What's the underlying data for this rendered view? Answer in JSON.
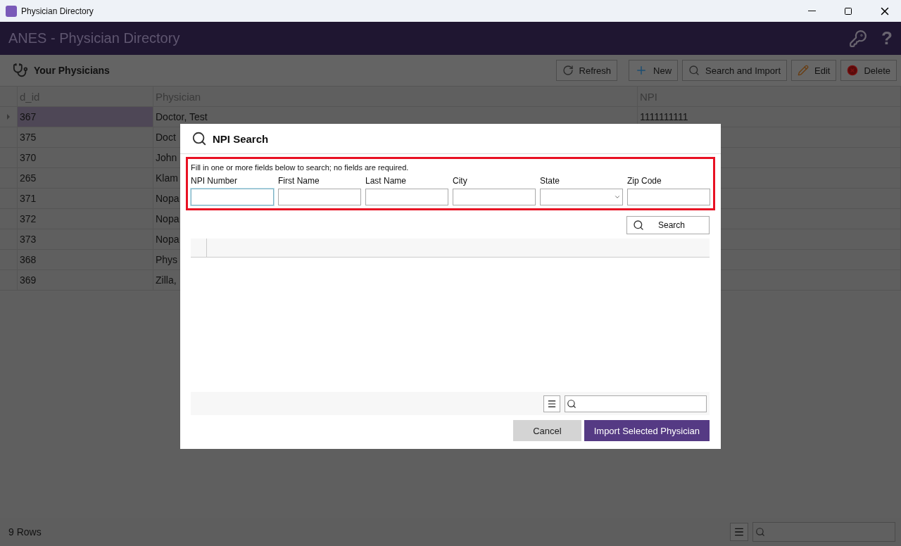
{
  "window": {
    "title": "Physician Directory"
  },
  "app_header": {
    "title": "ANES - Physician Directory",
    "help": "?"
  },
  "toolbar": {
    "title": "Your Physicians",
    "buttons": [
      {
        "label": "Refresh",
        "kind": "refresh"
      },
      {
        "label": "New",
        "kind": "new"
      },
      {
        "label": "Search and Import",
        "kind": "search"
      },
      {
        "label": "Edit",
        "kind": "edit"
      },
      {
        "label": "Delete",
        "kind": "delete"
      }
    ]
  },
  "table": {
    "columns": [
      "d_id",
      "Physician",
      "NPI"
    ],
    "rows": [
      {
        "d_id": "367",
        "physician": "Doctor, Test",
        "npi": "1111111111",
        "selected": true
      },
      {
        "d_id": "375",
        "physician": "Doct",
        "selected": false
      },
      {
        "d_id": "370",
        "physician": "John",
        "selected": false
      },
      {
        "d_id": "265",
        "physician": "Klam",
        "selected": false
      },
      {
        "d_id": "371",
        "physician": "Nopa",
        "selected": false
      },
      {
        "d_id": "372",
        "physician": "Nopa",
        "selected": false
      },
      {
        "d_id": "373",
        "physician": "Nopa",
        "selected": false
      },
      {
        "d_id": "368",
        "physician": "Phys",
        "selected": false
      },
      {
        "d_id": "369",
        "physician": "Zilla,",
        "selected": false
      }
    ]
  },
  "status_bar": {
    "row_count": "9 Rows"
  },
  "dialog": {
    "title": "NPI Search",
    "instructions": "Fill in one or more fields below to search; no fields are required.",
    "fields": [
      {
        "label": "NPI Number",
        "kind": "text",
        "focused": true
      },
      {
        "label": "First Name",
        "kind": "text",
        "focused": false
      },
      {
        "label": "Last Name",
        "kind": "text",
        "focused": false
      },
      {
        "label": "City",
        "kind": "text",
        "focused": false
      },
      {
        "label": "State",
        "kind": "select",
        "focused": false
      },
      {
        "label": "Zip Code",
        "kind": "text",
        "focused": false
      }
    ],
    "search_button": "Search",
    "buttons": [
      {
        "label": "Cancel",
        "kind": "secondary"
      },
      {
        "label": "Import Selected Physician",
        "kind": "primary"
      }
    ]
  }
}
